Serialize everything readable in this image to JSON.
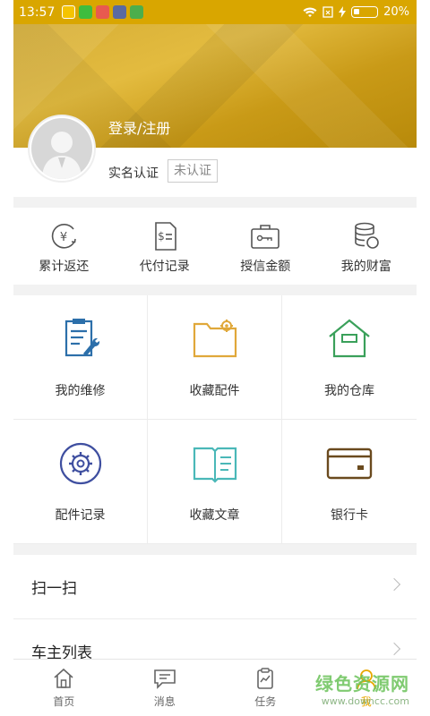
{
  "status_bar": {
    "time": "13:57",
    "battery": "20%",
    "color": "#d9a600"
  },
  "profile": {
    "login_label": "登录/注册",
    "realname_label": "实名认证",
    "realname_status": "未认证"
  },
  "stats": [
    {
      "label": "累计返还",
      "icon": "yen-return-icon"
    },
    {
      "label": "代付记录",
      "icon": "bill-icon"
    },
    {
      "label": "授信金额",
      "icon": "briefcase-key-icon"
    },
    {
      "label": "我的财富",
      "icon": "coins-icon"
    }
  ],
  "grid": [
    {
      "label": "我的维修",
      "icon": "repair-clipboard-icon",
      "color": "#2c6faa"
    },
    {
      "label": "收藏配件",
      "icon": "folder-gear-icon",
      "color": "#e0a83a"
    },
    {
      "label": "我的仓库",
      "icon": "warehouse-icon",
      "color": "#3aa05a"
    },
    {
      "label": "配件记录",
      "icon": "gear-circle-icon",
      "color": "#3f4fa0"
    },
    {
      "label": "收藏文章",
      "icon": "open-book-icon",
      "color": "#4ab8b8"
    },
    {
      "label": "银行卡",
      "icon": "bank-card-icon",
      "color": "#6a4a1e"
    }
  ],
  "menu": [
    {
      "label": "扫一扫"
    },
    {
      "label": "车主列表"
    }
  ],
  "tabs": [
    {
      "label": "首页",
      "icon": "home-icon"
    },
    {
      "label": "消息",
      "icon": "message-icon"
    },
    {
      "label": "任务",
      "icon": "task-icon"
    },
    {
      "label": "我",
      "icon": "user-icon",
      "active": true
    }
  ],
  "watermark": {
    "text": "绿色资源网",
    "url": "www.downcc.com"
  }
}
